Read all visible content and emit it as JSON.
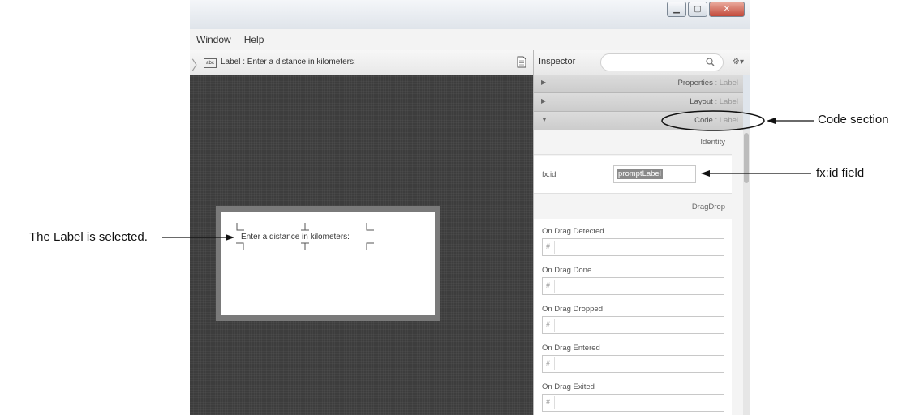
{
  "menu": [
    "Window",
    "Help"
  ],
  "breadcrumb": {
    "icon_text": "abc",
    "text": "Label : Enter a distance in kilometers:"
  },
  "canvas": {
    "selected_label": "Enter a distance in kilometers:"
  },
  "inspector": {
    "title": "Inspector",
    "sections": [
      {
        "name": "Properties",
        "sub": " : Label",
        "expanded": false
      },
      {
        "name": "Layout",
        "sub": " : Label",
        "expanded": false
      },
      {
        "name": "Code",
        "sub": " : Label",
        "expanded": true
      }
    ],
    "identity": {
      "heading": "Identity",
      "fxid_label": "fx:id",
      "fxid_value": "promptLabel"
    },
    "dragdrop": {
      "heading": "DragDrop",
      "events": [
        "On Drag Detected",
        "On Drag Done",
        "On Drag Dropped",
        "On Drag Entered",
        "On Drag Exited"
      ],
      "placeholder": "#"
    }
  },
  "callouts": {
    "code_section": "Code section",
    "fxid_field": "fx:id field",
    "label_selected": "The Label is selected."
  },
  "icons": [
    "minimize-icon",
    "maximize-icon",
    "close-icon",
    "document-icon",
    "search-icon",
    "gear-icon",
    "expand-arrow-icon",
    "collapse-arrow-icon"
  ]
}
